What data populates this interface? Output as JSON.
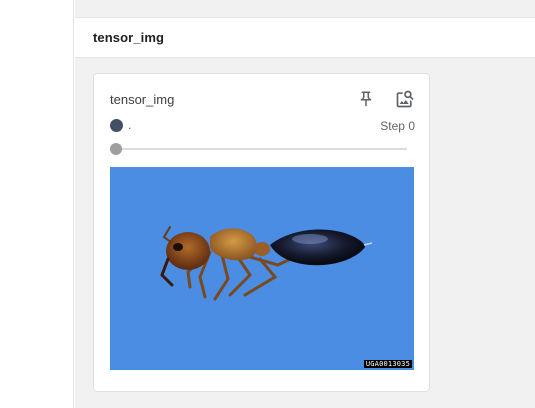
{
  "group": {
    "title": "tensor_img"
  },
  "card": {
    "title": "tensor_img",
    "pin_icon": "pin-icon",
    "view_icon": "image-search-icon",
    "run": {
      "name": ".",
      "color": "#425066"
    },
    "step_label": "Step 0",
    "slider": {
      "value": 0
    },
    "image": {
      "description_icon": "ant-photo",
      "watermark": "UGA0013035",
      "background": "#4a8de3"
    }
  }
}
